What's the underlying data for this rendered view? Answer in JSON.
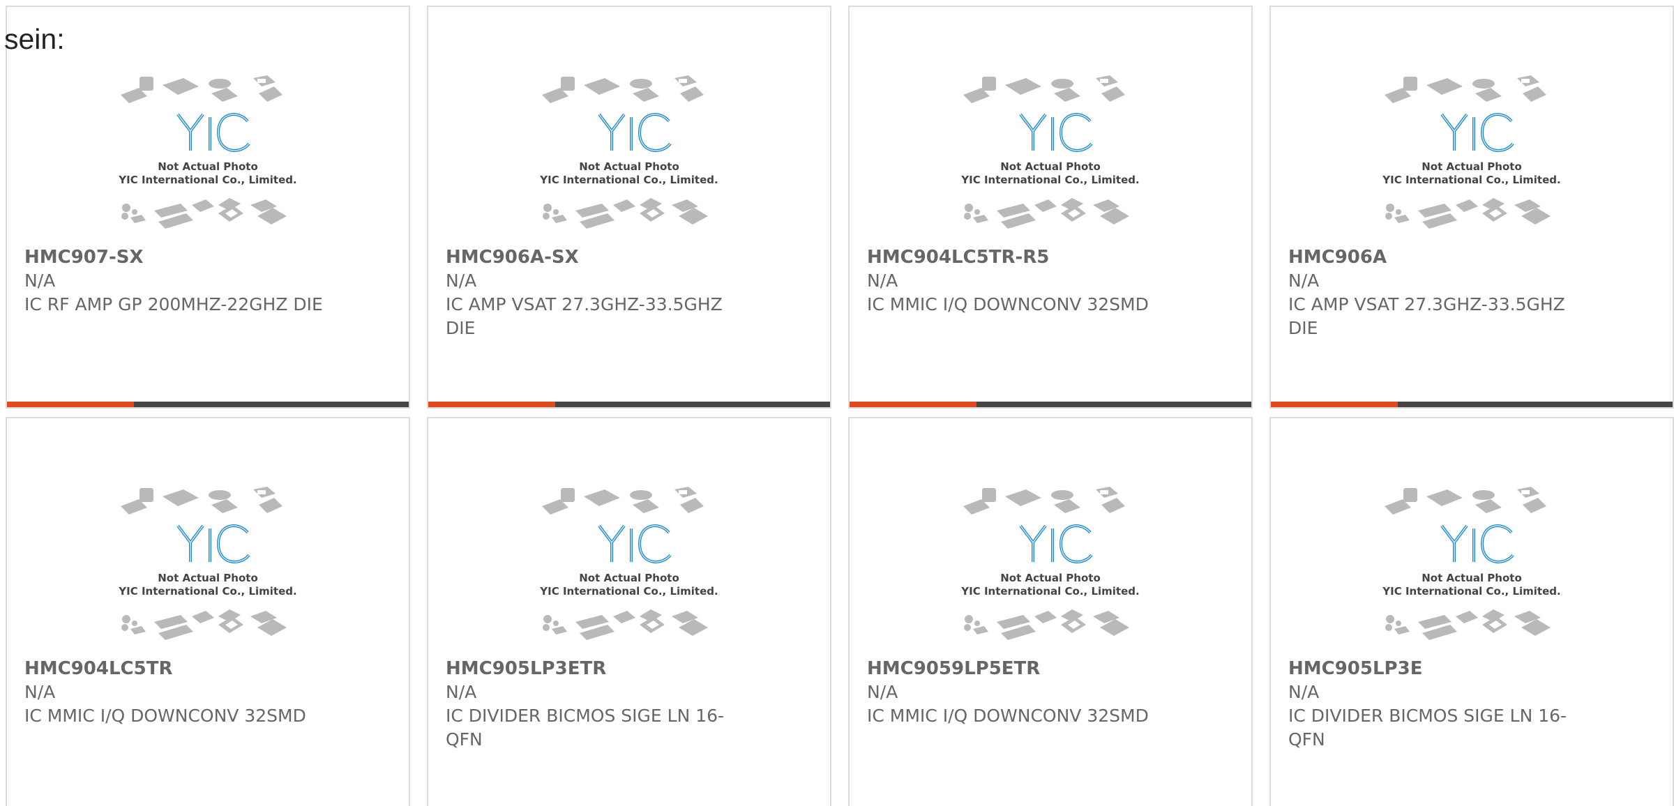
{
  "intro_text": "sein:",
  "placeholder": {
    "caption_line1": "Not Actual Photo",
    "caption_line2": "YIC International Co., Limited.",
    "logo_text": "YIC",
    "logo_color": "#1e88c8"
  },
  "colors": {
    "accent_bar": "#e24a1e",
    "dark_bar": "#444444",
    "text": "#666666"
  },
  "products": [
    {
      "part_number": "HMC907-SX",
      "manufacturer": "N/A",
      "description": "IC RF AMP GP 200MHZ-22GHZ DIE"
    },
    {
      "part_number": "HMC906A-SX",
      "manufacturer": "N/A",
      "description": "IC AMP VSAT 27.3GHZ-33.5GHZ DIE"
    },
    {
      "part_number": "HMC904LC5TR-R5",
      "manufacturer": "N/A",
      "description": "IC MMIC I/Q DOWNCONV 32SMD"
    },
    {
      "part_number": "HMC906A",
      "manufacturer": "N/A",
      "description": "IC AMP VSAT 27.3GHZ-33.5GHZ DIE"
    },
    {
      "part_number": "HMC904LC5TR",
      "manufacturer": "N/A",
      "description": "IC MMIC I/Q DOWNCONV 32SMD"
    },
    {
      "part_number": "HMC905LP3ETR",
      "manufacturer": "N/A",
      "description": "IC DIVIDER BICMOS SIGE LN 16-QFN"
    },
    {
      "part_number": "HMC9059LP5ETR",
      "manufacturer": "N/A",
      "description": "IC MMIC I/Q DOWNCONV 32SMD"
    },
    {
      "part_number": "HMC905LP3E",
      "manufacturer": "N/A",
      "description": "IC DIVIDER BICMOS SIGE LN 16-QFN"
    }
  ]
}
